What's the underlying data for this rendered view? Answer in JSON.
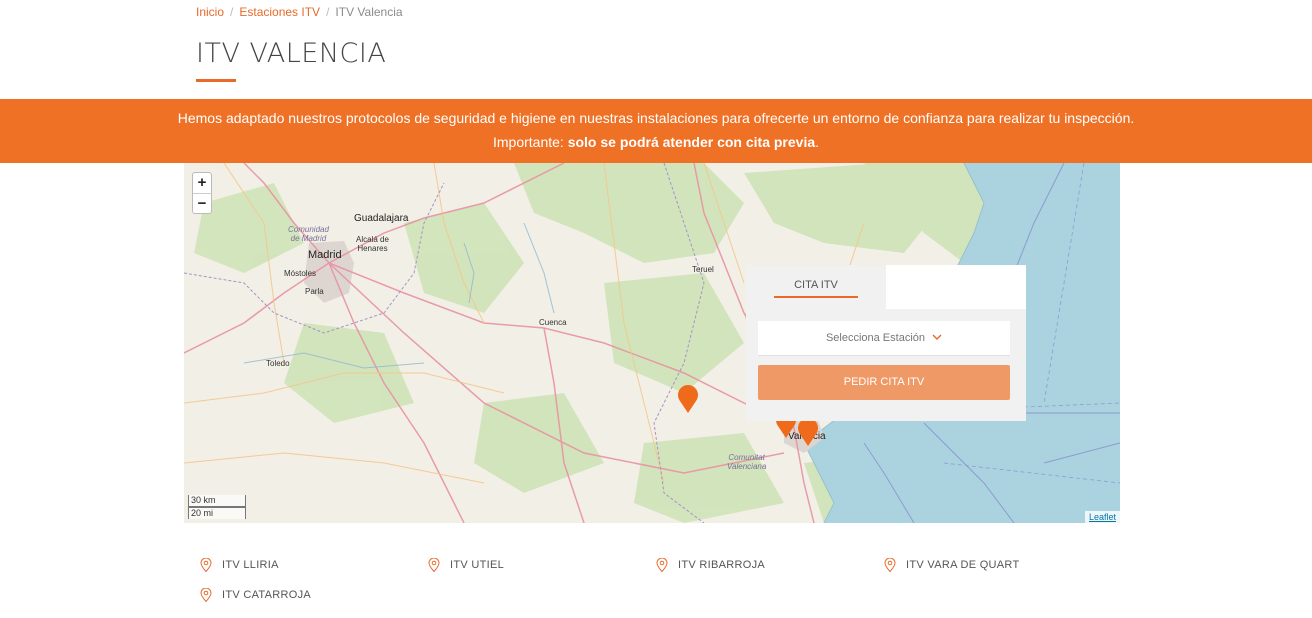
{
  "breadcrumb": {
    "home": "Inicio",
    "sep1": "/",
    "section": "Estaciones ITV",
    "sep2": "/",
    "current": "ITV Valencia"
  },
  "page": {
    "title": "ITV VALENCIA",
    "accent_color": "#e8692a"
  },
  "alert": {
    "line1": "Hemos adaptado nuestros protocolos de seguridad e higiene en nuestras instalaciones para ofrecerte un entorno de confianza para realizar tu inspección.",
    "line2_prefix": "Importante:",
    "line2_bold": "solo se podrá atender con cita previa",
    "line2_suffix": ".",
    "bg_color": "#ef7125"
  },
  "map": {
    "zoom_in": "+",
    "zoom_out": "−",
    "scale_km": "30 km",
    "scale_mi": "20 mi",
    "attribution": "Leaflet",
    "labels": {
      "guadalajara": "Guadalajara",
      "comunidad_madrid_1": "Comunidad",
      "comunidad_madrid_2": "de Madrid",
      "alcala_1": "Alcalá de",
      "alcala_2": "Henares",
      "madrid": "Madrid",
      "mostoles": "Móstoles",
      "parla": "Parla",
      "toledo": "Toledo",
      "cuenca": "Cuenca",
      "teruel": "Teruel",
      "valencia": "Valencia",
      "comunitat_1": "Comunitat",
      "comunitat_2": "Valenciana"
    }
  },
  "booking": {
    "tab_active": "CITA ITV",
    "select_placeholder": "Selecciona Estación",
    "submit": "PEDIR CITA ITV"
  },
  "stations": [
    {
      "name": "ITV LLIRIA"
    },
    {
      "name": "ITV UTIEL"
    },
    {
      "name": "ITV RIBARROJA"
    },
    {
      "name": "ITV VARA DE QUART"
    },
    {
      "name": "ITV CATARROJA"
    }
  ]
}
